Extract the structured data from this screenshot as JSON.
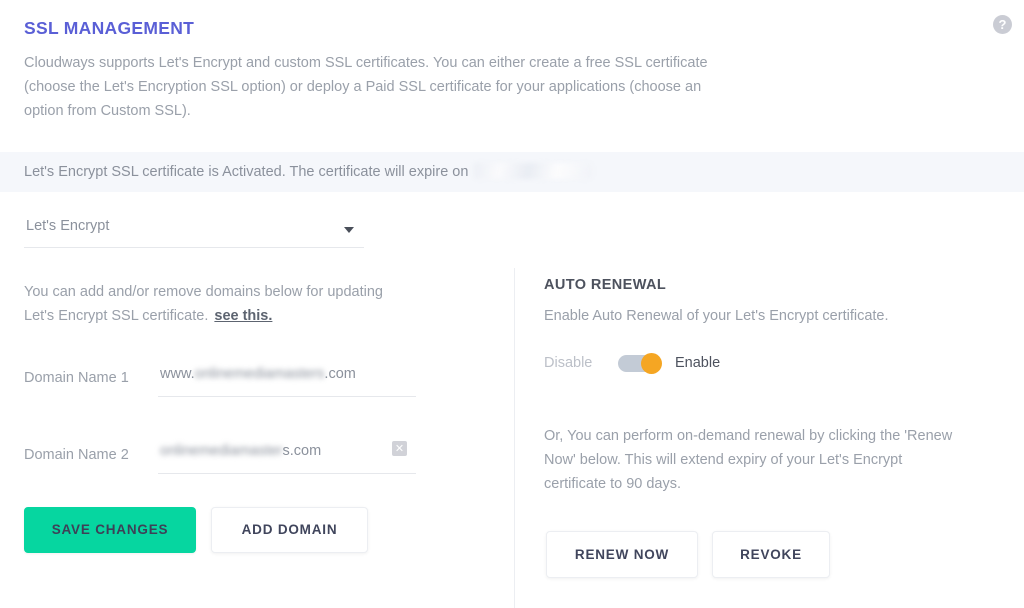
{
  "header": {
    "title": "SSL MANAGEMENT",
    "intro": "Cloudways supports Let's Encrypt and custom SSL certificates. You can either create a free SSL certificate (choose the Let's Encryption SSL option) or deploy a Paid SSL certificate for your applications (choose an option from Custom SSL).",
    "help_icon": "help-circle-icon",
    "help_glyph": "?"
  },
  "banner": {
    "message": "Let's Encrypt SSL certificate is Activated. The certificate will expire on",
    "expiry_date_redacted": true,
    "background": "#f5f7fb"
  },
  "ssl_type_select": {
    "value": "Let's Encrypt",
    "caret_icon": "chevron-down-icon"
  },
  "domains": {
    "description_line1": "You can add and/or remove domains below for updating",
    "description_line2": "Let's Encrypt SSL certificate.",
    "see_this_link": "see this.",
    "rows": [
      {
        "label": "Domain Name 1",
        "value_clear_prefix": "www.",
        "value_blurred": "onlinemediamasters",
        "value_clear_suffix": ".com",
        "removable": false
      },
      {
        "label": "Domain Name 2",
        "value_clear_prefix": "",
        "value_blurred": "onlinemediamaster",
        "value_clear_suffix": "s.com",
        "removable": true,
        "remove_icon": "close-x-icon",
        "remove_glyph": "✕"
      }
    ],
    "save_button": "SAVE CHANGES",
    "add_button": "ADD DOMAIN"
  },
  "auto_renewal": {
    "heading": "AUTO RENEWAL",
    "description": "Enable Auto Renewal of your Let's Encrypt certificate.",
    "toggle": {
      "off_label": "Disable",
      "on_label": "Enable",
      "state": "Enable",
      "track_color": "#c3cbd6",
      "knob_color": "#f5a623"
    },
    "note": "Or, You can perform on-demand renewal by clicking the 'Renew Now' below. This will extend expiry of your Let's Encrypt certificate to 90 days.",
    "renew_button": "RENEW NOW",
    "revoke_button": "REVOKE"
  },
  "colors": {
    "title": "#5a5fd6",
    "primary_button": "#06d6a0",
    "text_muted": "#9aa0aa",
    "accent_orange": "#f5a623"
  }
}
